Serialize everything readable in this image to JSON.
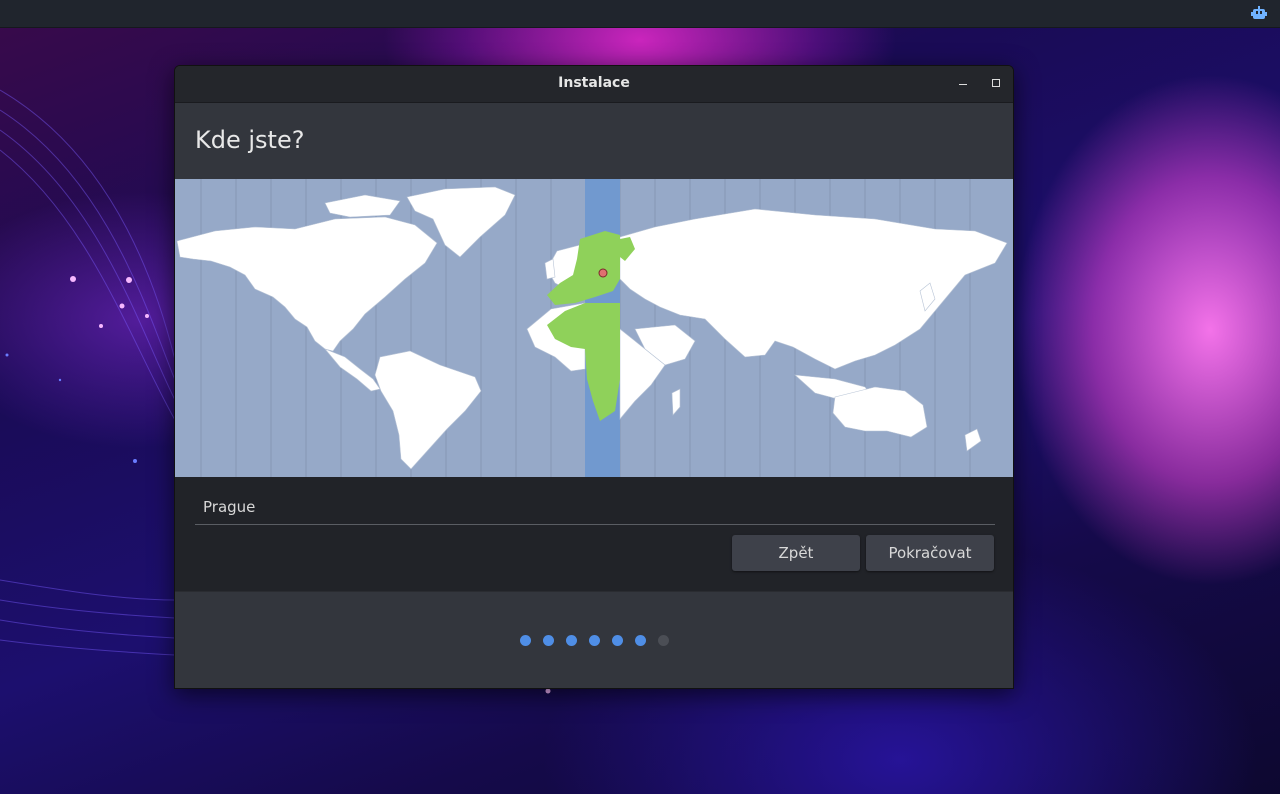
{
  "window": {
    "title": "Instalace",
    "heading": "Kde jste?"
  },
  "timezone": {
    "value": "Prague",
    "selected_zone_color": "#8fd15a",
    "highlight_column_color": "#7199cf",
    "ocean_color": "#96a9c8",
    "land_color": "#ffffff"
  },
  "buttons": {
    "back": "Zpět",
    "next": "Pokračovat"
  },
  "progress": {
    "steps_total": 7,
    "steps_completed": 6,
    "active_color": "#4f8ee6",
    "inactive_color": "#4b4e55"
  },
  "icons": {
    "tray": "network-robot-icon",
    "minimize": "minimize-icon",
    "maximize": "maximize-icon",
    "location_marker": "location-pin-icon"
  }
}
